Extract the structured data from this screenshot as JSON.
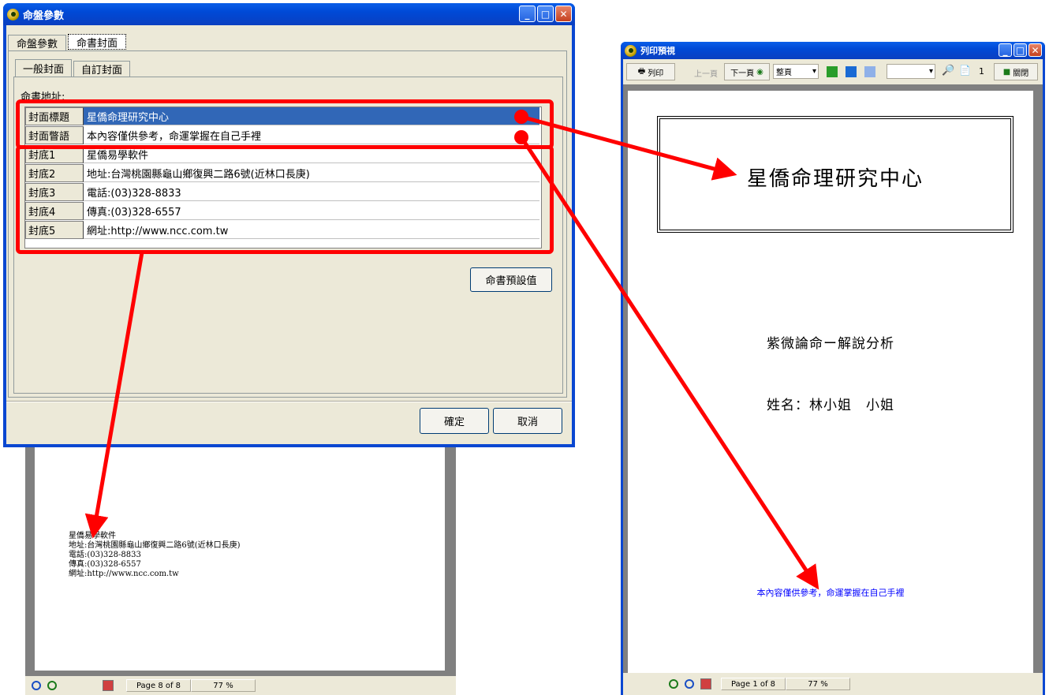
{
  "dialog": {
    "title": "命盤參數",
    "tabs": [
      "命盤參數",
      "命書封面"
    ],
    "subtabs": [
      "一般封面",
      "自訂封面"
    ],
    "address_label": "命書地址:",
    "rows": [
      {
        "key": "封面標題",
        "value": "星僑命理研究中心"
      },
      {
        "key": "封面瞥語",
        "value": "本內容僅供參考，命運掌握在自己手裡"
      },
      {
        "key": "封底1",
        "value": "星僑易學軟件"
      },
      {
        "key": "封底2",
        "value": "地址:台灣桃園縣龜山鄉復興二路6號(近林口長庚)"
      },
      {
        "key": "封底3",
        "value": "電話:(03)328-8833"
      },
      {
        "key": "封底4",
        "value": "傳真:(03)328-6557"
      },
      {
        "key": "封底5",
        "value": "網址:http://www.ncc.com.tw"
      }
    ],
    "default_button": "命書預設值",
    "ok_button": "確定",
    "cancel_button": "取消"
  },
  "back_preview": {
    "lines": [
      "星僑易學軟件",
      "地址:台灣桃園縣龜山鄉復興二路6號(近林口長庚)",
      "電話:(03)328-8833",
      "傳真:(03)328-6557",
      "網址:http://www.ncc.com.tw"
    ],
    "page_info": "Page 8 of 8",
    "zoom": "77 %"
  },
  "print_preview": {
    "title": "列印預視",
    "toolbar": {
      "print": "列印",
      "prev": "上一頁",
      "next": "下一頁",
      "fit": "整頁",
      "page_num": "1",
      "close": "關閉"
    },
    "cover_title": "星僑命理研究中心",
    "subtitle": "紫微論命ー解說分析",
    "name_line": "姓名：林小姐　小姐",
    "motto": "本內容僅供參考，命運掌握在自己手裡",
    "page_info": "Page 1 of 8",
    "zoom": "77 %"
  },
  "colors": {
    "xp_blue": "#0a47d1",
    "highlight": "#3167b7",
    "annotation": "#ff0000",
    "motto": "#0000ff"
  }
}
